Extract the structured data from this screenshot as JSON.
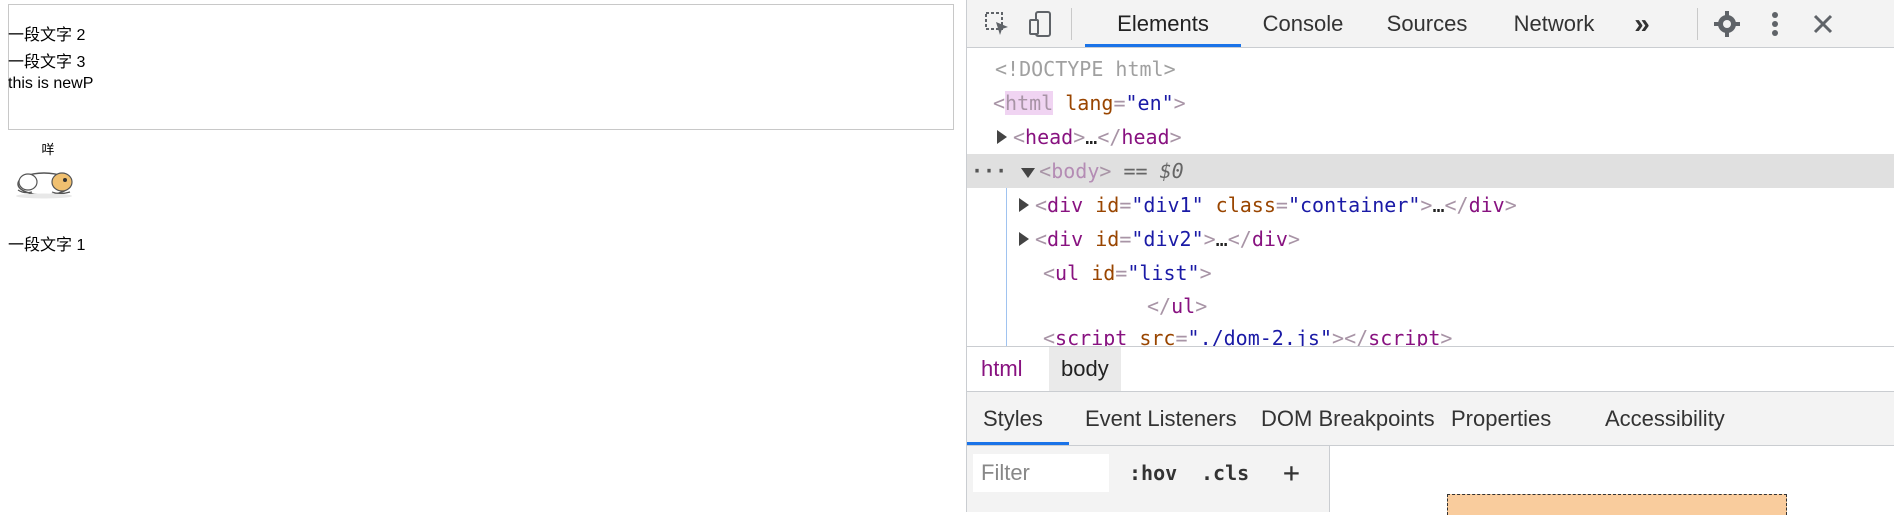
{
  "page": {
    "p2": "一段文字 2",
    "p3": "一段文字 3",
    "new_p": "this is newP",
    "p1": "一段文字 1",
    "image_caption": "咩"
  },
  "devtools": {
    "tabs": [
      "Elements",
      "Console",
      "Sources",
      "Network"
    ],
    "more_tabs": "»",
    "dom": {
      "doctype": "<!DOCTYPE html>",
      "html_open_tag": "html",
      "html_lang_attr": "lang",
      "html_lang_val": "en",
      "head_text": "head",
      "head_ellipsis": "…",
      "body_tag": "body",
      "body_eq": " == $0",
      "div1_tag": "div",
      "div1_id_attr": "id",
      "div1_id_val": "div1",
      "div1_class_attr": "class",
      "div1_class_val": "container",
      "div2_id_val": "div2",
      "ul_tag": "ul",
      "ul_id_val": "list",
      "script_tag": "script",
      "script_src_attr": "src",
      "script_src_val": "./dom-2.js"
    },
    "breadcrumb": [
      "html",
      "body"
    ],
    "lower_tabs": [
      "Styles",
      "Event Listeners",
      "DOM Breakpoints",
      "Properties",
      "Accessibility"
    ],
    "filter": {
      "placeholder": "Filter",
      "hov": ":hov",
      "cls": ".cls",
      "add": "+"
    }
  },
  "colors": {
    "accent": "#1a73e8",
    "tag": "#881280",
    "attr": "#994500",
    "value": "#1a1aa6",
    "selected_row": "#e0e0e0",
    "margin_box": "#f9cc9d"
  }
}
